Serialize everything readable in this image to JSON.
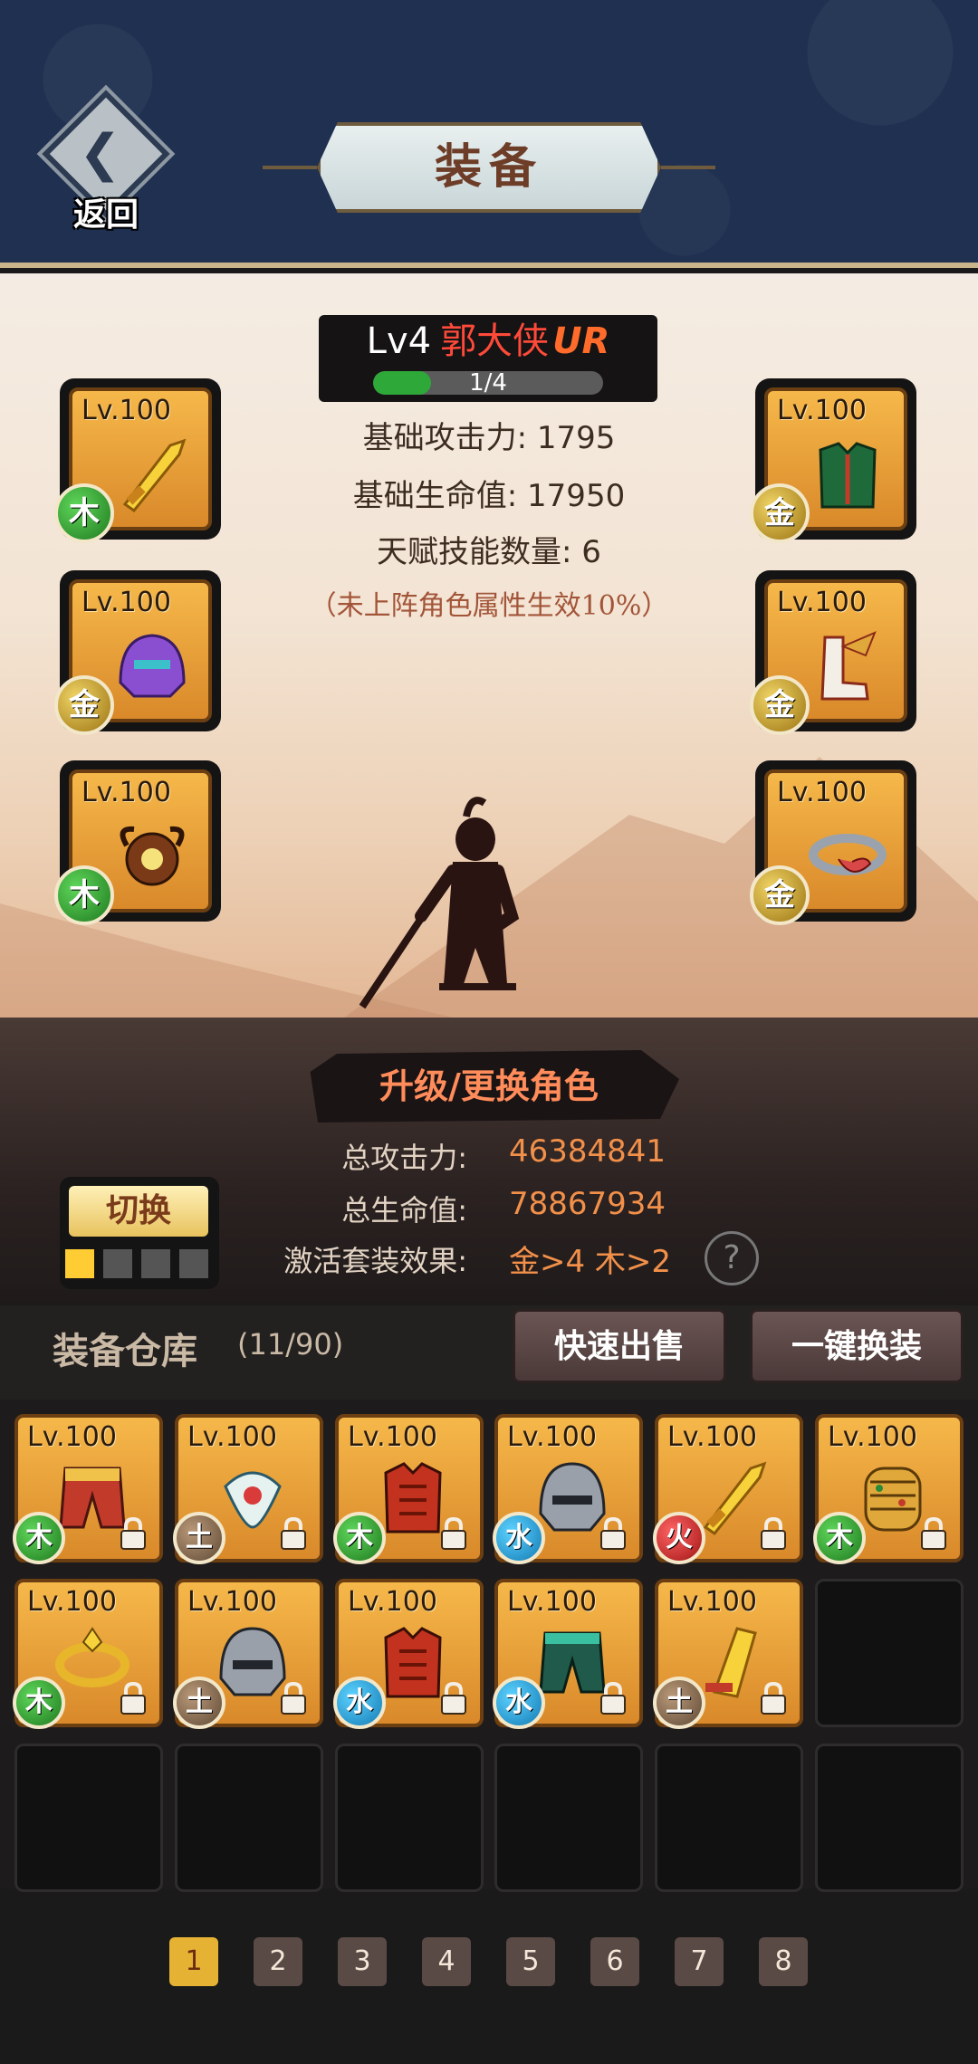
{
  "header": {
    "back_label": "返回",
    "title": "装备"
  },
  "hero": {
    "level": "Lv4",
    "name": "郭大侠",
    "rarity": "UR",
    "progress_text": "1/4",
    "progress_fraction": 0.25,
    "stats": [
      "基础攻击力: 1795",
      "基础生命值: 17950",
      "天赋技能数量: 6"
    ],
    "note": "（未上阵角色属性生效10%）"
  },
  "equipped": {
    "left": [
      {
        "level": "Lv.100",
        "element": "木",
        "element_type": "wood",
        "icon": "golden-sword-icon"
      },
      {
        "level": "Lv.100",
        "element": "金",
        "element_type": "gold",
        "icon": "purple-helmet-icon"
      },
      {
        "level": "Lv.100",
        "element": "木",
        "element_type": "wood",
        "icon": "horned-amulet-icon"
      }
    ],
    "right": [
      {
        "level": "Lv.100",
        "element": "金",
        "element_type": "gold",
        "icon": "green-armor-icon"
      },
      {
        "level": "Lv.100",
        "element": "金",
        "element_type": "gold",
        "icon": "winged-boots-icon"
      },
      {
        "level": "Lv.100",
        "element": "金",
        "element_type": "gold",
        "icon": "dragon-ring-icon"
      }
    ]
  },
  "upgrade": {
    "label": "升级/更换角色"
  },
  "totals": {
    "attack_label": "总攻击力:",
    "attack_value": "46384841",
    "hp_label": "总生命值:",
    "hp_value": "78867934",
    "set_label": "激活套装效果:",
    "set_value": "金>4  木>2"
  },
  "switch": {
    "label": "切换",
    "active_index": 0,
    "count": 4
  },
  "warehouse": {
    "title": "装备仓库",
    "count": "(11/90)",
    "quick_sell": "快速出售",
    "one_click_equip": "一键换装",
    "items": [
      {
        "level": "Lv.100",
        "element": "木",
        "element_type": "wood",
        "icon": "red-pants-icon"
      },
      {
        "level": "Lv.100",
        "element": "土",
        "element_type": "earth",
        "icon": "jade-pendant-icon"
      },
      {
        "level": "Lv.100",
        "element": "木",
        "element_type": "wood",
        "icon": "red-armor-icon"
      },
      {
        "level": "Lv.100",
        "element": "水",
        "element_type": "water",
        "icon": "steel-helmet-icon"
      },
      {
        "level": "Lv.100",
        "element": "火",
        "element_type": "fire",
        "icon": "golden-sword-icon"
      },
      {
        "level": "Lv.100",
        "element": "木",
        "element_type": "wood",
        "icon": "jeweled-bracer-icon"
      },
      {
        "level": "Lv.100",
        "element": "木",
        "element_type": "wood",
        "icon": "golden-ring-icon"
      },
      {
        "level": "Lv.100",
        "element": "土",
        "element_type": "earth",
        "icon": "steel-helmet-icon"
      },
      {
        "level": "Lv.100",
        "element": "水",
        "element_type": "water",
        "icon": "red-armor-icon"
      },
      {
        "level": "Lv.100",
        "element": "水",
        "element_type": "water",
        "icon": "green-pants-icon"
      },
      {
        "level": "Lv.100",
        "element": "土",
        "element_type": "earth",
        "icon": "golden-blade-icon"
      }
    ],
    "total_cells": 18
  },
  "pagination": {
    "pages": [
      "1",
      "2",
      "3",
      "4",
      "5",
      "6",
      "7",
      "8"
    ],
    "active": 0
  },
  "colors": {
    "header_bg": "#1f3050",
    "wood": "#1f7a1f",
    "gold": "#9c7412",
    "earth": "#5f4a36",
    "water": "#137bb5",
    "fire": "#a11414",
    "item_bg": "#f6b84a",
    "accent_orange": "#f2904a"
  }
}
